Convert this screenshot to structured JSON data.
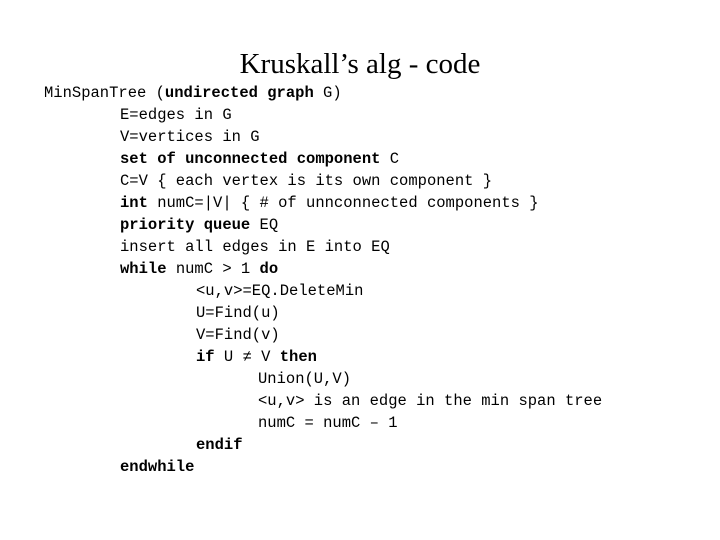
{
  "slide": {
    "title": "Kruskall’s alg - code",
    "background_color": "#ffffff",
    "text_color": "#000000"
  },
  "code": {
    "language_style": "pseudocode",
    "lines": [
      {
        "indent": 0,
        "segments": [
          {
            "text": "MinSpanTree (",
            "bold": false
          },
          {
            "text": "undirected graph",
            "bold": true
          },
          {
            "text": " G)",
            "bold": false
          }
        ]
      },
      {
        "indent": 1,
        "segments": [
          {
            "text": "E=edges in G",
            "bold": false
          }
        ]
      },
      {
        "indent": 1,
        "segments": [
          {
            "text": "V=vertices in G",
            "bold": false
          }
        ]
      },
      {
        "indent": 1,
        "segments": [
          {
            "text": "set of unconnected component",
            "bold": true
          },
          {
            "text": " C",
            "bold": false
          }
        ]
      },
      {
        "indent": 1,
        "segments": [
          {
            "text": "C=V { each vertex is its own component }",
            "bold": false
          }
        ]
      },
      {
        "indent": 1,
        "segments": [
          {
            "text": "int",
            "bold": true
          },
          {
            "text": " numC=|V| { # of unnconnected components }",
            "bold": false
          }
        ]
      },
      {
        "indent": 1,
        "segments": [
          {
            "text": "priority queue",
            "bold": true
          },
          {
            "text": " EQ",
            "bold": false
          }
        ]
      },
      {
        "indent": 1,
        "segments": [
          {
            "text": "insert all edges in E into EQ",
            "bold": false
          }
        ]
      },
      {
        "indent": 1,
        "segments": [
          {
            "text": "while",
            "bold": true
          },
          {
            "text": " numC > 1 ",
            "bold": false
          },
          {
            "text": "do",
            "bold": true
          }
        ]
      },
      {
        "indent": 2,
        "segments": [
          {
            "text": "<u,v>=EQ.DeleteMin",
            "bold": false
          }
        ]
      },
      {
        "indent": 2,
        "segments": [
          {
            "text": "U=Find(u)",
            "bold": false
          }
        ]
      },
      {
        "indent": 2,
        "segments": [
          {
            "text": "V=Find(v)",
            "bold": false
          }
        ]
      },
      {
        "indent": 2,
        "segments": [
          {
            "text": "if",
            "bold": true
          },
          {
            "text": " U ≠ V ",
            "bold": false
          },
          {
            "text": "then",
            "bold": true
          }
        ]
      },
      {
        "indent": 3,
        "segments": [
          {
            "text": "Union(U,V)",
            "bold": false
          }
        ]
      },
      {
        "indent": 3,
        "segments": [
          {
            "text": "<u,v> is an edge in the min span tree",
            "bold": false
          }
        ]
      },
      {
        "indent": 3,
        "segments": [
          {
            "text": "numC = numC – 1",
            "bold": false
          }
        ]
      },
      {
        "indent": 2,
        "segments": [
          {
            "text": "endif",
            "bold": true
          }
        ]
      },
      {
        "indent": 1,
        "segments": [
          {
            "text": "endwhile",
            "bold": true
          }
        ]
      }
    ]
  }
}
